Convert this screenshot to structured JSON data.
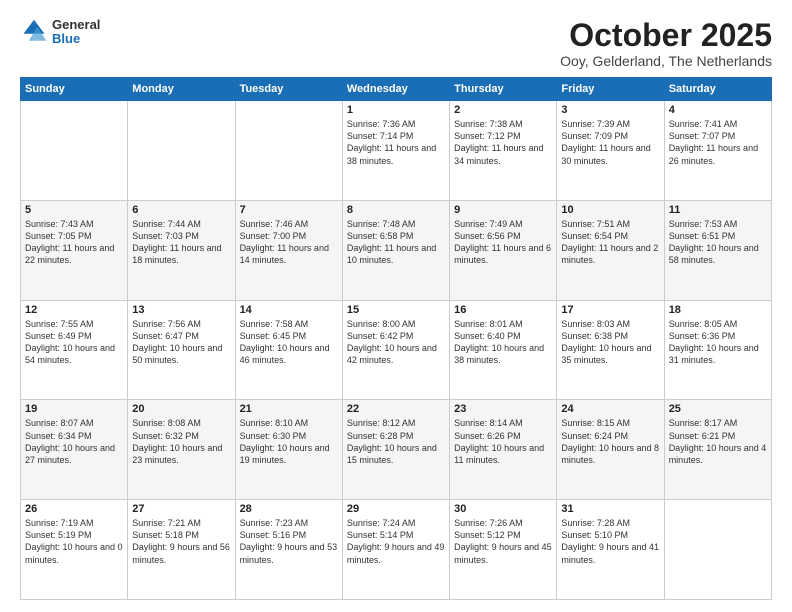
{
  "header": {
    "logo": {
      "general": "General",
      "blue": "Blue"
    },
    "title": "October 2025",
    "subtitle": "Ooy, Gelderland, The Netherlands"
  },
  "days_of_week": [
    "Sunday",
    "Monday",
    "Tuesday",
    "Wednesday",
    "Thursday",
    "Friday",
    "Saturday"
  ],
  "weeks": [
    [
      {
        "num": "",
        "text": ""
      },
      {
        "num": "",
        "text": ""
      },
      {
        "num": "",
        "text": ""
      },
      {
        "num": "1",
        "text": "Sunrise: 7:36 AM\nSunset: 7:14 PM\nDaylight: 11 hours\nand 38 minutes."
      },
      {
        "num": "2",
        "text": "Sunrise: 7:38 AM\nSunset: 7:12 PM\nDaylight: 11 hours\nand 34 minutes."
      },
      {
        "num": "3",
        "text": "Sunrise: 7:39 AM\nSunset: 7:09 PM\nDaylight: 11 hours\nand 30 minutes."
      },
      {
        "num": "4",
        "text": "Sunrise: 7:41 AM\nSunset: 7:07 PM\nDaylight: 11 hours\nand 26 minutes."
      }
    ],
    [
      {
        "num": "5",
        "text": "Sunrise: 7:43 AM\nSunset: 7:05 PM\nDaylight: 11 hours\nand 22 minutes."
      },
      {
        "num": "6",
        "text": "Sunrise: 7:44 AM\nSunset: 7:03 PM\nDaylight: 11 hours\nand 18 minutes."
      },
      {
        "num": "7",
        "text": "Sunrise: 7:46 AM\nSunset: 7:00 PM\nDaylight: 11 hours\nand 14 minutes."
      },
      {
        "num": "8",
        "text": "Sunrise: 7:48 AM\nSunset: 6:58 PM\nDaylight: 11 hours\nand 10 minutes."
      },
      {
        "num": "9",
        "text": "Sunrise: 7:49 AM\nSunset: 6:56 PM\nDaylight: 11 hours\nand 6 minutes."
      },
      {
        "num": "10",
        "text": "Sunrise: 7:51 AM\nSunset: 6:54 PM\nDaylight: 11 hours\nand 2 minutes."
      },
      {
        "num": "11",
        "text": "Sunrise: 7:53 AM\nSunset: 6:51 PM\nDaylight: 10 hours\nand 58 minutes."
      }
    ],
    [
      {
        "num": "12",
        "text": "Sunrise: 7:55 AM\nSunset: 6:49 PM\nDaylight: 10 hours\nand 54 minutes."
      },
      {
        "num": "13",
        "text": "Sunrise: 7:56 AM\nSunset: 6:47 PM\nDaylight: 10 hours\nand 50 minutes."
      },
      {
        "num": "14",
        "text": "Sunrise: 7:58 AM\nSunset: 6:45 PM\nDaylight: 10 hours\nand 46 minutes."
      },
      {
        "num": "15",
        "text": "Sunrise: 8:00 AM\nSunset: 6:42 PM\nDaylight: 10 hours\nand 42 minutes."
      },
      {
        "num": "16",
        "text": "Sunrise: 8:01 AM\nSunset: 6:40 PM\nDaylight: 10 hours\nand 38 minutes."
      },
      {
        "num": "17",
        "text": "Sunrise: 8:03 AM\nSunset: 6:38 PM\nDaylight: 10 hours\nand 35 minutes."
      },
      {
        "num": "18",
        "text": "Sunrise: 8:05 AM\nSunset: 6:36 PM\nDaylight: 10 hours\nand 31 minutes."
      }
    ],
    [
      {
        "num": "19",
        "text": "Sunrise: 8:07 AM\nSunset: 6:34 PM\nDaylight: 10 hours\nand 27 minutes."
      },
      {
        "num": "20",
        "text": "Sunrise: 8:08 AM\nSunset: 6:32 PM\nDaylight: 10 hours\nand 23 minutes."
      },
      {
        "num": "21",
        "text": "Sunrise: 8:10 AM\nSunset: 6:30 PM\nDaylight: 10 hours\nand 19 minutes."
      },
      {
        "num": "22",
        "text": "Sunrise: 8:12 AM\nSunset: 6:28 PM\nDaylight: 10 hours\nand 15 minutes."
      },
      {
        "num": "23",
        "text": "Sunrise: 8:14 AM\nSunset: 6:26 PM\nDaylight: 10 hours\nand 11 minutes."
      },
      {
        "num": "24",
        "text": "Sunrise: 8:15 AM\nSunset: 6:24 PM\nDaylight: 10 hours\nand 8 minutes."
      },
      {
        "num": "25",
        "text": "Sunrise: 8:17 AM\nSunset: 6:21 PM\nDaylight: 10 hours\nand 4 minutes."
      }
    ],
    [
      {
        "num": "26",
        "text": "Sunrise: 7:19 AM\nSunset: 5:19 PM\nDaylight: 10 hours\nand 0 minutes."
      },
      {
        "num": "27",
        "text": "Sunrise: 7:21 AM\nSunset: 5:18 PM\nDaylight: 9 hours\nand 56 minutes."
      },
      {
        "num": "28",
        "text": "Sunrise: 7:23 AM\nSunset: 5:16 PM\nDaylight: 9 hours\nand 53 minutes."
      },
      {
        "num": "29",
        "text": "Sunrise: 7:24 AM\nSunset: 5:14 PM\nDaylight: 9 hours\nand 49 minutes."
      },
      {
        "num": "30",
        "text": "Sunrise: 7:26 AM\nSunset: 5:12 PM\nDaylight: 9 hours\nand 45 minutes."
      },
      {
        "num": "31",
        "text": "Sunrise: 7:28 AM\nSunset: 5:10 PM\nDaylight: 9 hours\nand 41 minutes."
      },
      {
        "num": "",
        "text": ""
      }
    ]
  ]
}
